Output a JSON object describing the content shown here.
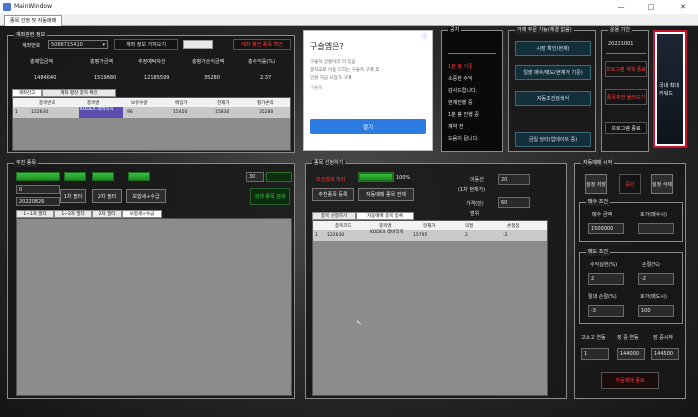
{
  "window": {
    "title": "MainWindow",
    "minimize": "—",
    "maximize": "□",
    "close": "✕"
  },
  "tabs": [
    "종목 선정 및 자동매매"
  ],
  "account": {
    "title": "계좌관련 정보",
    "acct_label": "계좌번호",
    "acct_value": "5088715410",
    "info_btn": "계좌 정보 가져오기",
    "auto_btn": "계좌 평잔 종목 확인",
    "headers": [
      "총매입금액",
      "총평가금액",
      "추정예탁자산",
      "총평가손익금액",
      "총수익률(%)"
    ],
    "values": [
      "1484640",
      "1519680",
      "12185599",
      "35280",
      "2.37"
    ],
    "tabs": [
      "계좌잔고",
      "계좌 평잔 종목 확인"
    ],
    "grid_headers": [
      "종목번호",
      "종목명",
      "보유수량",
      "매입가",
      "현재가",
      "평가손익"
    ],
    "grid_row": [
      "122630",
      "KODEX 레버리지",
      "96",
      "15450",
      "15830",
      "35280"
    ]
  },
  "ad": {
    "title": "구슬옙은?",
    "line1": "구슬쏙 상황이라 이 있음",
    "line2": "중학교로 이용 드리는 구슬쏙 구매 후",
    "line3": "인원 지금 시장가 구매",
    "line4": "구슬쏙",
    "button": "열기"
  },
  "notice": {
    "title": "공지",
    "lines": [
      "",
      "1분 봉 기준",
      "소중한 수익",
      "감사드립니다.",
      "현재진행 중",
      "1분 봉 진행 중",
      "계약 전",
      "도움이 됩니다."
    ]
  },
  "trade_menu": {
    "title": "거래 주문 기능(체결 없음)",
    "buttons": [
      "시장 확인(현재)",
      "일괄 매수/매도(현재가 기준)",
      "자동조건검색식",
      "금일 당타(업데이트 중)"
    ]
  },
  "oper": {
    "title": "운용 기간",
    "date": "20221001",
    "check_btn": "프로그램 계획 종료",
    "auto_btn": "종목추천 불러오기",
    "close_btn": "프로그램 종료"
  },
  "side_ad": {
    "line1": "국내 최대",
    "line2": "키워드"
  },
  "search": {
    "title": "추천 종목",
    "value1": "0",
    "date": "20220826",
    "btn1": "1차 필터",
    "btn2": "2차 필터",
    "btn3": "보합세+수급",
    "num": "30",
    "green_btn": "검색 종목 검색",
    "tabs": [
      "1~1차 필터",
      "1~2차 필터",
      "2차 필터",
      "보합세+수급"
    ]
  },
  "selection": {
    "title": "종목 선정하기",
    "progress_label": "조건검색 처리",
    "progress": "100%",
    "btn1": "추천종목 등록",
    "btn2": "자동매매 종목 전체",
    "count_label": "이동선",
    "count_value": "20",
    "sub_label": "(1차 현재가)",
    "price_label": "가격(만)",
    "price_value": "60",
    "range_label": "범위",
    "tabs": [
      "종목 선정하기",
      "자동매매 종목 등록"
    ],
    "grid_headers": [
      "종목코드",
      "종목명",
      "현재가",
      "익절",
      "손절점"
    ],
    "grid_row": [
      "122630",
      "KODEX 레버리지",
      "15795",
      "2",
      "-2"
    ]
  },
  "auto": {
    "title": "자동매매 시작",
    "btn_setting": "설정 저장",
    "btn_mid": "중단",
    "btn_reset": "설정 삭제",
    "buy_title": "매수 조건",
    "buy_amount_label": "매수 금액",
    "buy_amount": "1500000",
    "buy_count_label": "호가(매수시)",
    "buy_count": "",
    "sell_title": "매도 조건",
    "profit_label": "수익실현(%)",
    "profit": "2",
    "loss_label": "손절(%)",
    "loss": "-2",
    "abs_loss_label": "절대 손절(%)",
    "abs_loss": "-3",
    "hold_label": "호가(매도시)",
    "hold": "100",
    "bottom_labels": [
      "고소고 연동",
      "장 중 연동",
      "장 중시작"
    ],
    "bottom_values": [
      "1",
      "144000",
      "144500"
    ],
    "start_btn": "자동매매 종료"
  },
  "colors": {
    "accent_red": "#ff3a3a",
    "green": "#2fb83a",
    "teal": "#13303a"
  }
}
